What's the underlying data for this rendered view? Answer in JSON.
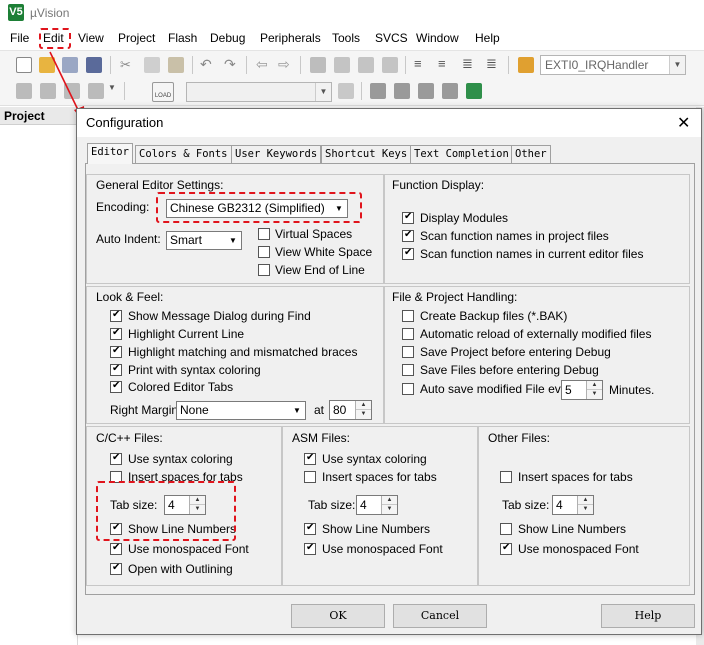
{
  "app": {
    "logo": "V5",
    "title": "µVision"
  },
  "menu": [
    "File",
    "Edit",
    "View",
    "Project",
    "Flash",
    "Debug",
    "Peripherals",
    "Tools",
    "SVCS",
    "Window",
    "Help"
  ],
  "toolbar": {
    "target_combo": "EXTI0_IRQHandler",
    "load_label": "LOAD"
  },
  "left_panel": {
    "title": "Project"
  },
  "dialog": {
    "title": "Configuration",
    "close_glyph": "✕",
    "tabs": [
      "Editor",
      "Colors & Fonts",
      "User Keywords",
      "Shortcut Keys",
      "Text Completion",
      "Other"
    ],
    "general": {
      "title": "General Editor Settings:",
      "encoding_label": "Encoding:",
      "encoding_value": "Chinese GB2312 (Simplified)",
      "auto_indent_label": "Auto Indent:",
      "auto_indent_value": "Smart",
      "virtual_spaces": "Virtual Spaces",
      "view_white_space": "View White Space",
      "view_end_of_line": "View End of Line"
    },
    "function_display": {
      "title": "Function Display:",
      "display_modules": "Display Modules",
      "scan_project": "Scan function names in project files",
      "scan_editor": "Scan function names in current editor files"
    },
    "look_feel": {
      "title": "Look & Feel:",
      "show_message": "Show Message Dialog during Find",
      "highlight_line": "Highlight Current Line",
      "highlight_braces": "Highlight matching and mismatched braces",
      "print_syntax": "Print with syntax coloring",
      "colored_tabs": "Colored Editor Tabs",
      "right_margin_label": "Right Margin:",
      "right_margin_value": "None",
      "at_label": "at",
      "at_value": "80"
    },
    "file_project": {
      "title": "File & Project Handling:",
      "backup": "Create Backup files (*.BAK)",
      "auto_reload": "Automatic reload of externally modified files",
      "save_project": "Save Project before entering Debug",
      "save_files": "Save Files before entering Debug",
      "auto_save": "Auto save modified File every",
      "auto_save_value": "5",
      "minutes": "Minutes."
    },
    "cpp": {
      "title": "C/C++ Files:",
      "syntax": "Use syntax coloring",
      "insert_spaces": "Insert spaces for tabs",
      "tab_size_label": "Tab size:",
      "tab_size_value": "4",
      "show_line_numbers": "Show Line Numbers",
      "monospaced": "Use monospaced Font",
      "outlining": "Open with Outlining"
    },
    "asm": {
      "title": "ASM Files:",
      "syntax": "Use syntax coloring",
      "insert_spaces": "Insert spaces for tabs",
      "tab_size_label": "Tab size:",
      "tab_size_value": "4",
      "show_line_numbers": "Show Line Numbers",
      "monospaced": "Use monospaced Font"
    },
    "other": {
      "title": "Other Files:",
      "insert_spaces": "Insert spaces for tabs",
      "tab_size_label": "Tab size:",
      "tab_size_value": "4",
      "show_line_numbers": "Show Line Numbers",
      "monospaced": "Use monospaced Font"
    },
    "buttons": {
      "ok": "OK",
      "cancel": "Cancel",
      "help": "Help"
    }
  },
  "annotation_color": "#e0141c"
}
